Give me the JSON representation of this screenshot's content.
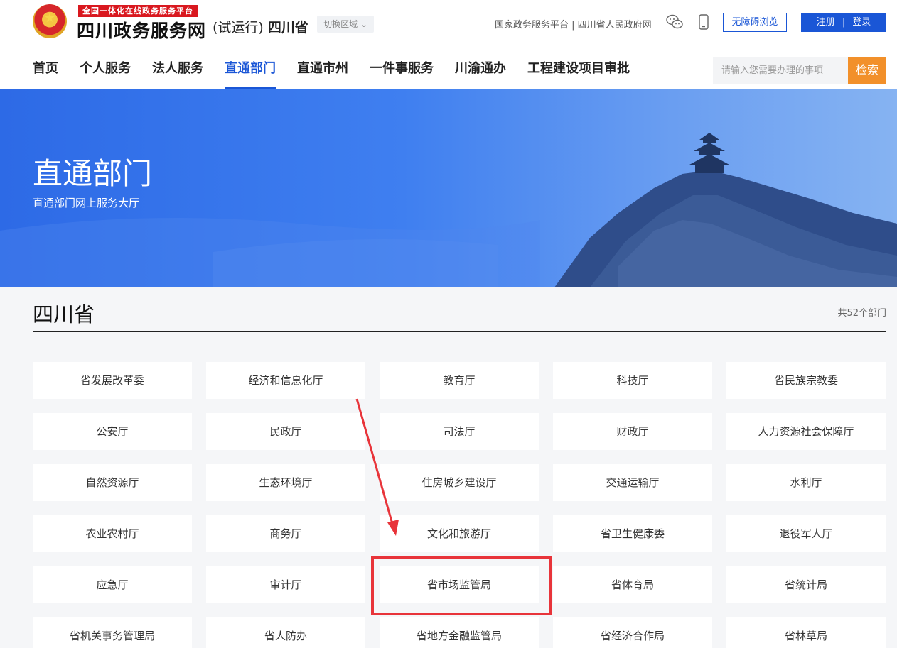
{
  "header": {
    "badge": "全国一体化在线政务服务平台",
    "site_name": "四川政务服务网",
    "site_sub_trial": "(试运行)",
    "site_sub_province": "四川省",
    "region_switch": "切换区域 ⌄",
    "top_links": "国家政务服务平台 | 四川省人民政府网",
    "accessibility": "无障碍浏览",
    "register": "注册",
    "login": "登录",
    "icons": [
      "wechat-icon",
      "mobile-icon"
    ]
  },
  "nav": {
    "items": [
      "首页",
      "个人服务",
      "法人服务",
      "直通部门",
      "直通市州",
      "一件事服务",
      "川渝通办",
      "工程建设项目审批"
    ],
    "active_index": 3,
    "search_placeholder": "请输入您需要办理的事项",
    "search_button": "检索"
  },
  "banner": {
    "title": "直通部门",
    "subtitle": "直通部门网上服务大厅"
  },
  "section": {
    "title": "四川省",
    "count": "共52个部门"
  },
  "departments": [
    "省发展改革委",
    "经济和信息化厅",
    "教育厅",
    "科技厅",
    "省民族宗教委",
    "公安厅",
    "民政厅",
    "司法厅",
    "财政厅",
    "人力资源社会保障厅",
    "自然资源厅",
    "生态环境厅",
    "住房城乡建设厅",
    "交通运输厅",
    "水利厅",
    "农业农村厅",
    "商务厅",
    "文化和旅游厅",
    "省卫生健康委",
    "退役军人厅",
    "应急厅",
    "审计厅",
    "省市场监管局",
    "省体育局",
    "省统计局",
    "省机关事务管理局",
    "省人防办",
    "省地方金融监管局",
    "省经济合作局",
    "省林草局"
  ],
  "colors": {
    "accent": "#1a56d6",
    "search_button": "#f2902a",
    "badge": "#d9181f",
    "annotation": "#e8343a"
  }
}
